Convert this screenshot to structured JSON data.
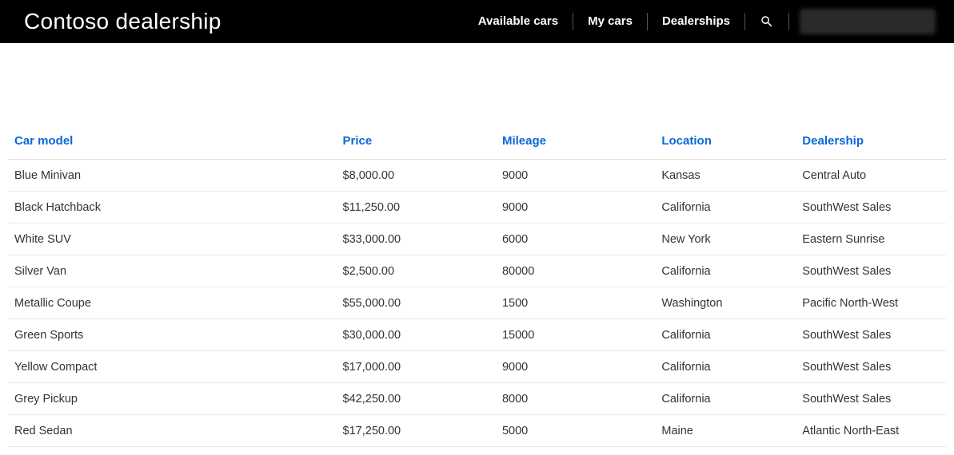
{
  "header": {
    "title": "Contoso dealership",
    "nav": [
      {
        "label": "Available cars"
      },
      {
        "label": "My cars"
      },
      {
        "label": "Dealerships"
      }
    ]
  },
  "table": {
    "columns": [
      "Car model",
      "Price",
      "Mileage",
      "Location",
      "Dealership"
    ],
    "rows": [
      {
        "model": "Blue Minivan",
        "price": "$8,000.00",
        "mileage": "9000",
        "location": "Kansas",
        "dealership": "Central Auto"
      },
      {
        "model": "Black Hatchback",
        "price": "$11,250.00",
        "mileage": "9000",
        "location": "California",
        "dealership": "SouthWest Sales"
      },
      {
        "model": "White SUV",
        "price": "$33,000.00",
        "mileage": "6000",
        "location": "New York",
        "dealership": "Eastern Sunrise"
      },
      {
        "model": "Silver Van",
        "price": "$2,500.00",
        "mileage": "80000",
        "location": "California",
        "dealership": "SouthWest Sales"
      },
      {
        "model": "Metallic Coupe",
        "price": "$55,000.00",
        "mileage": "1500",
        "location": "Washington",
        "dealership": "Pacific North-West"
      },
      {
        "model": "Green Sports",
        "price": "$30,000.00",
        "mileage": "15000",
        "location": "California",
        "dealership": "SouthWest Sales"
      },
      {
        "model": "Yellow Compact",
        "price": "$17,000.00",
        "mileage": "9000",
        "location": "California",
        "dealership": "SouthWest Sales"
      },
      {
        "model": "Grey Pickup",
        "price": "$42,250.00",
        "mileage": "8000",
        "location": "California",
        "dealership": "SouthWest Sales"
      },
      {
        "model": "Red Sedan",
        "price": "$17,250.00",
        "mileage": "5000",
        "location": "Maine",
        "dealership": "Atlantic North-East"
      }
    ]
  }
}
